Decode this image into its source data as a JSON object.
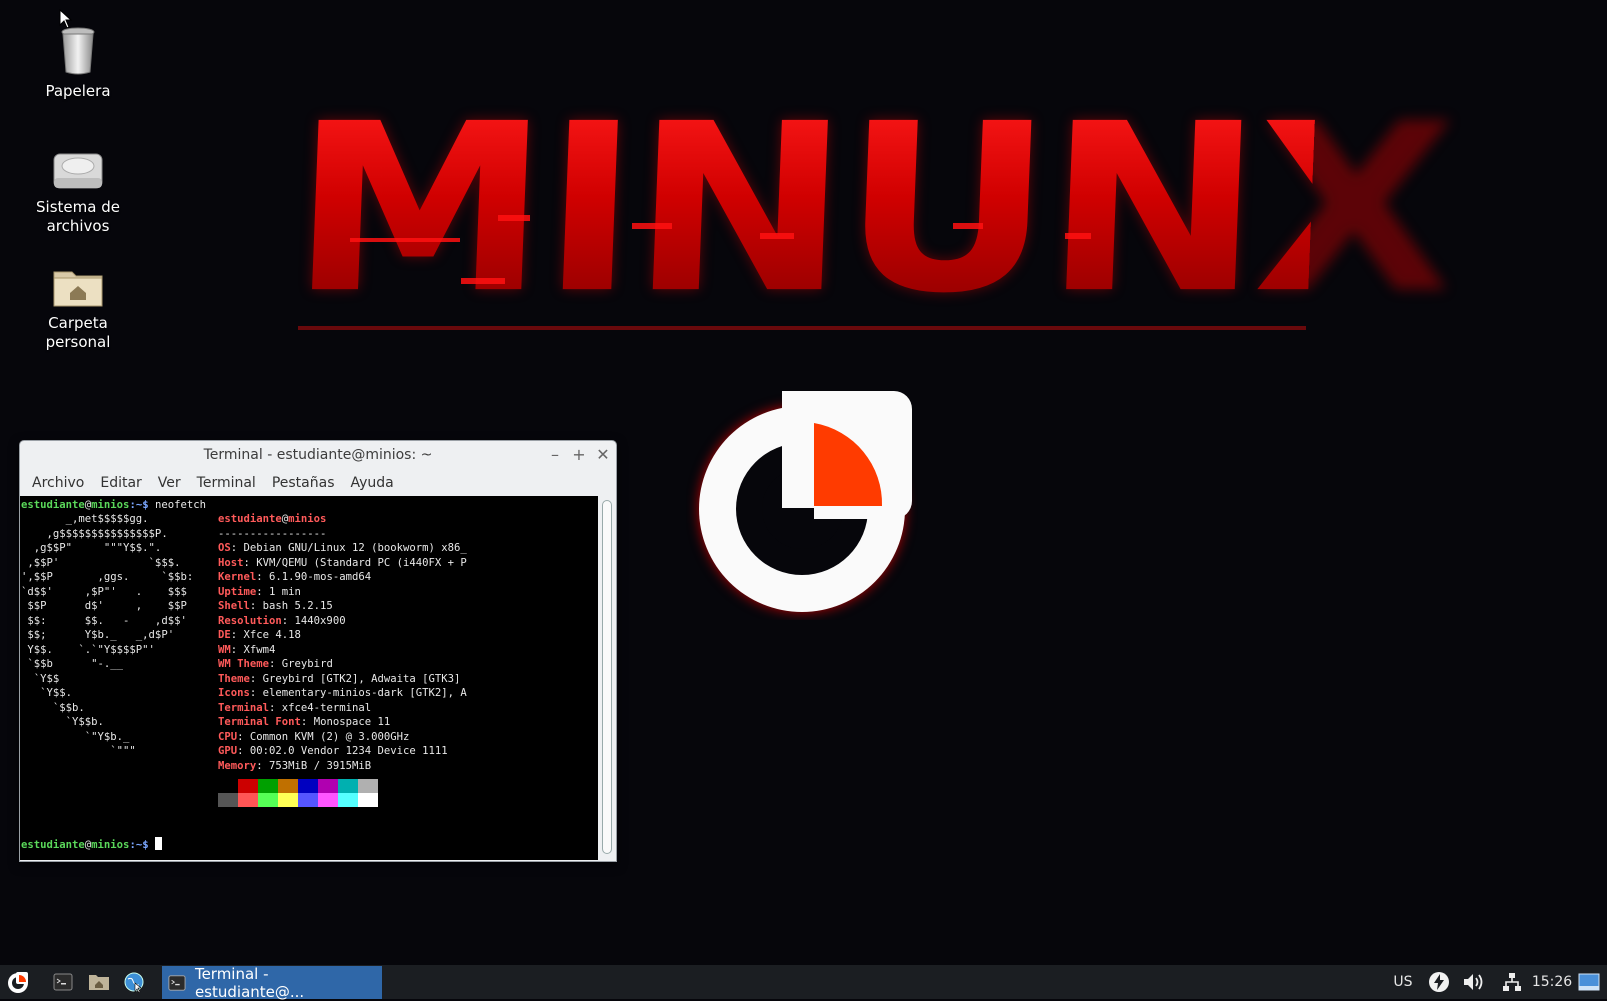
{
  "desktop": {
    "icons": [
      {
        "label": "Papelera"
      },
      {
        "label": "Sistema de archivos",
        "line1": "Sistema de",
        "line2": "archivos"
      },
      {
        "label": "Carpeta personal",
        "line1": "Carpeta",
        "line2": "personal"
      }
    ],
    "wallpaper": {
      "title": "MINUNX",
      "brand_color": "#c40000",
      "accent_color": "#ff3b00"
    }
  },
  "terminal": {
    "title": "Terminal - estudiante@minios: ~",
    "menu": [
      "Archivo",
      "Editar",
      "Ver",
      "Terminal",
      "Pestañas",
      "Ayuda"
    ],
    "prompt_user": "estudiante",
    "prompt_host": "minios",
    "prompt_suffix": ":~$ ",
    "command": "neofetch",
    "header_user": "estudiante",
    "header_host": "minios",
    "separator": "-----------------",
    "info": [
      {
        "key": "OS",
        "value": "Debian GNU/Linux 12 (bookworm) x86_"
      },
      {
        "key": "Host",
        "value": "KVM/QEMU (Standard PC (i440FX + P"
      },
      {
        "key": "Kernel",
        "value": "6.1.90-mos-amd64"
      },
      {
        "key": "Uptime",
        "value": "1 min"
      },
      {
        "key": "Shell",
        "value": "bash 5.2.15"
      },
      {
        "key": "Resolution",
        "value": "1440x900"
      },
      {
        "key": "DE",
        "value": "Xfce 4.18"
      },
      {
        "key": "WM",
        "value": "Xfwm4"
      },
      {
        "key": "WM Theme",
        "value": "Greybird"
      },
      {
        "key": "Theme",
        "value": "Greybird [GTK2], Adwaita [GTK3]"
      },
      {
        "key": "Icons",
        "value": "elementary-minios-dark [GTK2], A"
      },
      {
        "key": "Terminal",
        "value": "xfce4-terminal"
      },
      {
        "key": "Terminal Font",
        "value": "Monospace 11"
      },
      {
        "key": "CPU",
        "value": "Common KVM (2) @ 3.000GHz"
      },
      {
        "key": "GPU",
        "value": "00:02.0 Vendor 1234 Device 1111"
      },
      {
        "key": "Memory",
        "value": "753MiB / 3915MiB"
      }
    ],
    "ascii_art": [
      "       _,met$$$$$gg.",
      "    ,g$$$$$$$$$$$$$$$P.",
      "  ,g$$P\"     \"\"\"Y$$.\".",
      " ,$$P'              `$$$.",
      "',$$P       ,ggs.     `$$b:",
      "`d$$'     ,$P\"'   .    $$$",
      " $$P      d$'     ,    $$P",
      " $$:      $$.   -    ,d$$'",
      " $$;      Y$b._   _,d$P'",
      " Y$$.    `.`\"Y$$$$P\"'",
      " `$$b      \"-.__",
      "  `Y$$",
      "   `Y$$.",
      "     `$$b.",
      "       `Y$$b.",
      "          `\"Y$b._",
      "              `\"\"\""
    ],
    "palette_top": [
      "#000000",
      "#cc0000",
      "#00a000",
      "#c07000",
      "#0000c0",
      "#b000b0",
      "#00b0b0",
      "#b0b0b0"
    ],
    "palette_bottom": [
      "#555555",
      "#ff5555",
      "#55ff55",
      "#ffff55",
      "#5555ff",
      "#ff55ff",
      "#55ffff",
      "#ffffff"
    ]
  },
  "taskbar": {
    "task_label": "Terminal - estudiante@...",
    "keyboard_layout": "US",
    "clock": "15:26"
  }
}
